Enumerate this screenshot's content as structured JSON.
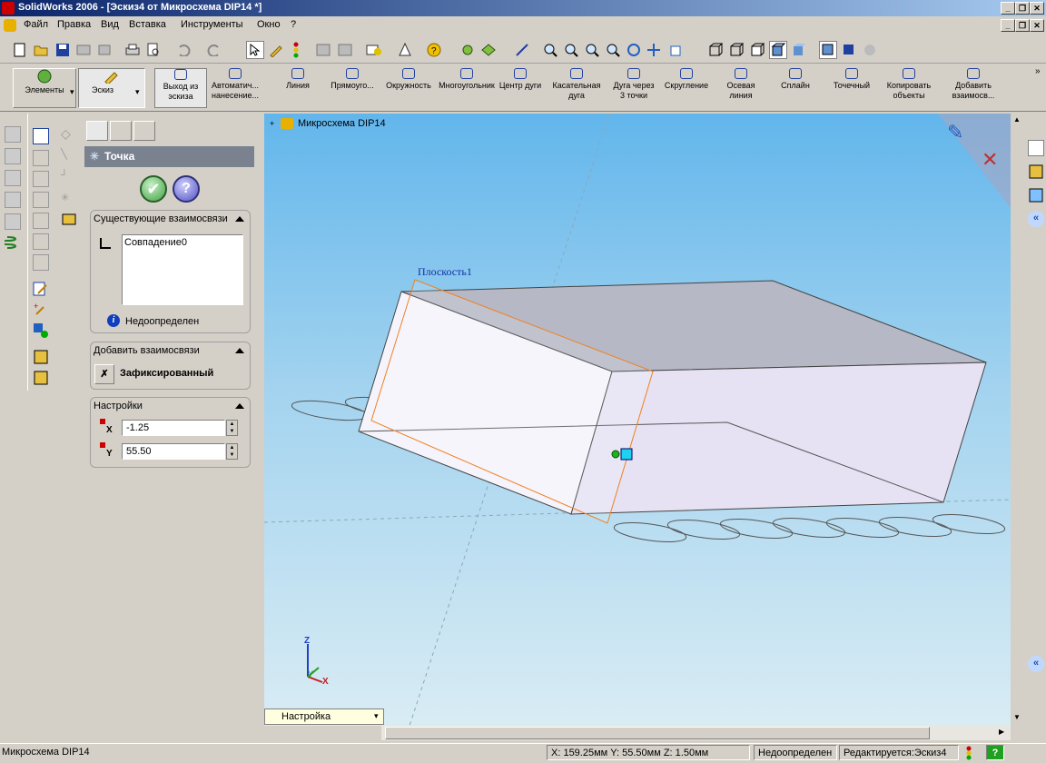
{
  "window": {
    "title": "SolidWorks 2006 - [Эскиз4 от Микросхема DIP14 *]"
  },
  "menu": {
    "items": [
      "Файл",
      "Правка",
      "Вид",
      "Вставка",
      "Инструменты",
      "Окно",
      "?"
    ]
  },
  "command_manager": {
    "tabs": [
      "Элементы",
      "Эскиз"
    ],
    "commands": [
      {
        "label": "Выход из\nэскиза",
        "icon": "exit-sketch-icon"
      },
      {
        "label": "Автоматич...\nнанесение...",
        "icon": "smart-dimension-icon"
      },
      {
        "label": "Линия",
        "icon": "line-icon"
      },
      {
        "label": "Прямоуго...",
        "icon": "rectangle-icon"
      },
      {
        "label": "Окружность",
        "icon": "circle-icon"
      },
      {
        "label": "Многоугольник",
        "icon": "polygon-icon"
      },
      {
        "label": "Центр дуги",
        "icon": "centerpoint-arc-icon"
      },
      {
        "label": "Касательная\nдуга",
        "icon": "tangent-arc-icon"
      },
      {
        "label": "Дуга через\n3 точки",
        "icon": "three-point-arc-icon"
      },
      {
        "label": "Скругление",
        "icon": "fillet-icon"
      },
      {
        "label": "Осевая\nлиния",
        "icon": "centerline-icon"
      },
      {
        "label": "Сплайн",
        "icon": "spline-icon"
      },
      {
        "label": "Точечный",
        "icon": "point-icon"
      },
      {
        "label": "Копировать\nобъекты",
        "icon": "copy-entities-icon"
      },
      {
        "label": "Добавить\nвзаимосв...",
        "icon": "add-relation-icon"
      }
    ]
  },
  "property_manager": {
    "title": "Точка",
    "existing_relations": {
      "header": "Существующие взаимосвязи",
      "items": [
        "Совпадение0"
      ],
      "status": "Недоопределен"
    },
    "add_relations": {
      "header": "Добавить взаимосвязи",
      "items": [
        "Зафиксированный"
      ]
    },
    "parameters": {
      "header": "Настройки",
      "x_label": "X",
      "x_value": "-1.25",
      "y_label": "Y",
      "y_value": "55.50"
    }
  },
  "graphics": {
    "tree_item": "Микросхема DIP14",
    "plane_label": "Плоскость1",
    "view_config": "Настройка",
    "axes": {
      "x": "X",
      "y": "Y",
      "z": "Z"
    }
  },
  "status": {
    "document": "Микросхема DIP14",
    "coordinates": "X: 159.25мм  Y: 55.50мм  Z: 1.50мм",
    "definition": "Недоопределен",
    "editing": "Редактируется:Эскиз4",
    "help": "?"
  },
  "colors": {
    "accent": "#0a246a",
    "viewport_top": "#62b6ec",
    "plane": "#f08020"
  }
}
